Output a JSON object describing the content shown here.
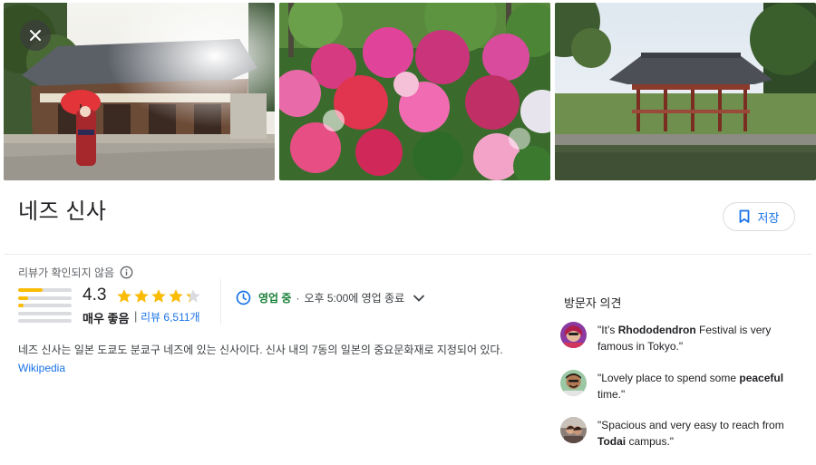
{
  "place": {
    "title": "네즈 신사",
    "save_label": "저장"
  },
  "icons": {
    "close": "close-icon",
    "bookmark": "bookmark-icon",
    "info": "info-icon",
    "clock": "clock-icon",
    "chevron": "chevron-down-icon",
    "star": "star-icon"
  },
  "colors": {
    "accent": "#1a73e8",
    "open_green": "#188038",
    "star": "#fbbc04"
  },
  "rating": {
    "unverified_label": "리뷰가 확인되지 않음",
    "score": "4.3",
    "score_value": 4.3,
    "label": "매우 좋음",
    "separator": "|",
    "reviews_text": "리뷰 6,511개",
    "histogram": [
      0.45,
      0.18,
      0.1,
      0.0,
      0.0
    ]
  },
  "hours": {
    "status": "영업 중",
    "dot": "·",
    "detail": "오후 5:00에 영업 종료"
  },
  "description": {
    "text": "네즈 신사는 일본 도쿄도 분쿄구 네즈에 있는 신사이다. 신사 내의 7동의 일본의 중요문화재로 지정되어 있다.",
    "source": "Wikipedia"
  },
  "opinions": {
    "title": "방문자 의견",
    "items": [
      {
        "pre": "\"It’s ",
        "bold": "Rhododendron",
        "post": " Festival is very famous in Tokyo.\""
      },
      {
        "pre": "\"Lovely place to spend some ",
        "bold": "peaceful",
        "post": " time.\""
      },
      {
        "pre": "\"Spacious and very easy to reach from ",
        "bold": "Todai",
        "post": " campus.\""
      }
    ]
  }
}
